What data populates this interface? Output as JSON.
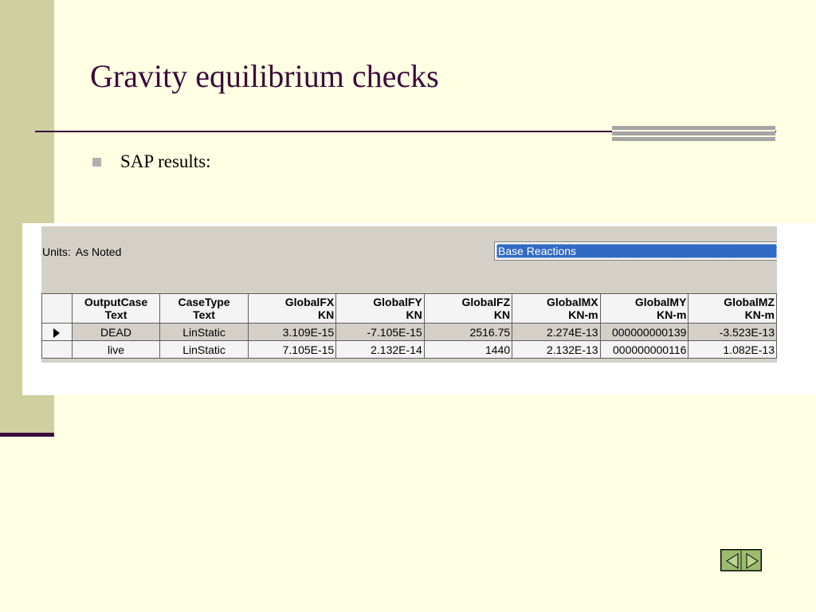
{
  "slide": {
    "title": "Gravity equilibrium checks",
    "bullet": "SAP results:"
  },
  "sap": {
    "units_label": "Units:",
    "units_value": "As Noted",
    "table_selector": "Base Reactions",
    "columns": [
      {
        "name": "OutputCase",
        "unit": "Text"
      },
      {
        "name": "CaseType",
        "unit": "Text"
      },
      {
        "name": "GlobalFX",
        "unit": "KN"
      },
      {
        "name": "GlobalFY",
        "unit": "KN"
      },
      {
        "name": "GlobalFZ",
        "unit": "KN"
      },
      {
        "name": "GlobalMX",
        "unit": "KN-m"
      },
      {
        "name": "GlobalMY",
        "unit": "KN-m"
      },
      {
        "name": "GlobalMZ",
        "unit": "KN-m"
      }
    ],
    "rows": [
      [
        "DEAD",
        "LinStatic",
        "3.109E-15",
        "-7.105E-15",
        "2516.75",
        "2.274E-13",
        "000000000139",
        "-3.523E-13"
      ],
      [
        "live",
        "LinStatic",
        "7.105E-15",
        "2.132E-14",
        "1440",
        "2.132E-13",
        "000000000116",
        "1.082E-13"
      ]
    ]
  },
  "colors": {
    "background": "#ffffe3",
    "sidebar": "#cfcf9f",
    "title": "#3b0b3b",
    "selection": "#316ac5",
    "nav_button": "#9bbb6f"
  },
  "nav": {
    "prev_icon": "triangle-left-icon",
    "next_icon": "triangle-right-icon"
  }
}
